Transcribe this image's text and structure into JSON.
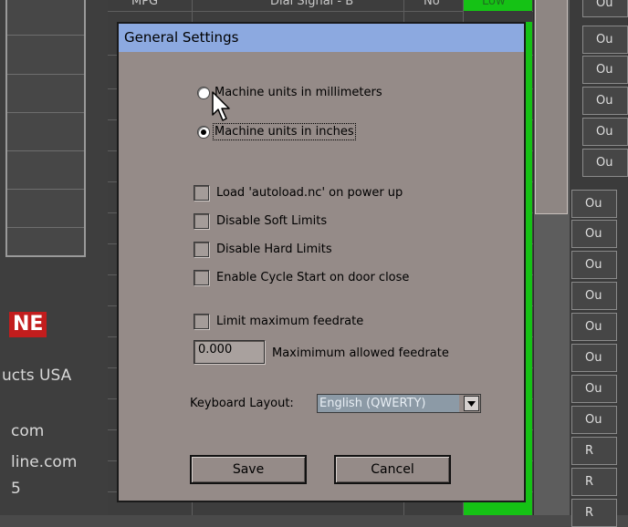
{
  "background": {
    "table_header": {
      "col1": "MPG",
      "col2": "Dial Signal - B",
      "col3": "No",
      "col4": "Low"
    },
    "left_panel": {
      "brand_fragment": "NE",
      "lines": [
        "ucts USA",
        "com",
        "line.com",
        "5"
      ]
    },
    "right_column": [
      "Ou",
      "Ou",
      "Ou",
      "Ou",
      "Ou",
      "Ou",
      "Ou",
      "Ou",
      "Ou",
      "Ou",
      "Ou",
      "Ou",
      "Ou",
      "Ou",
      "R",
      "R",
      "R"
    ]
  },
  "dialog": {
    "title": "General Settings",
    "units": {
      "options": [
        "Machine units in millimeters",
        "Machine units in inches"
      ],
      "selected": "Machine units in inches"
    },
    "checkboxes": [
      {
        "label": "Load 'autoload.nc' on power up",
        "checked": false
      },
      {
        "label": "Disable Soft Limits",
        "checked": false
      },
      {
        "label": "Disable Hard Limits",
        "checked": false
      },
      {
        "label": "Enable Cycle Start on door close",
        "checked": false
      }
    ],
    "limit_feedrate": {
      "label": "Limit maximum feedrate",
      "checked": false
    },
    "max_feedrate": {
      "value": "0.000",
      "label": "Maximimum allowed feedrate"
    },
    "keyboard_layout": {
      "label": "Keyboard Layout:",
      "value": "English (QWERTY)"
    },
    "buttons": {
      "save": "Save",
      "cancel": "Cancel"
    }
  },
  "colors": {
    "dialog_bg": "#958b88",
    "titlebar": "#8ca9e0",
    "green_cell": "#15c215",
    "brand_red": "#c21d1d"
  }
}
